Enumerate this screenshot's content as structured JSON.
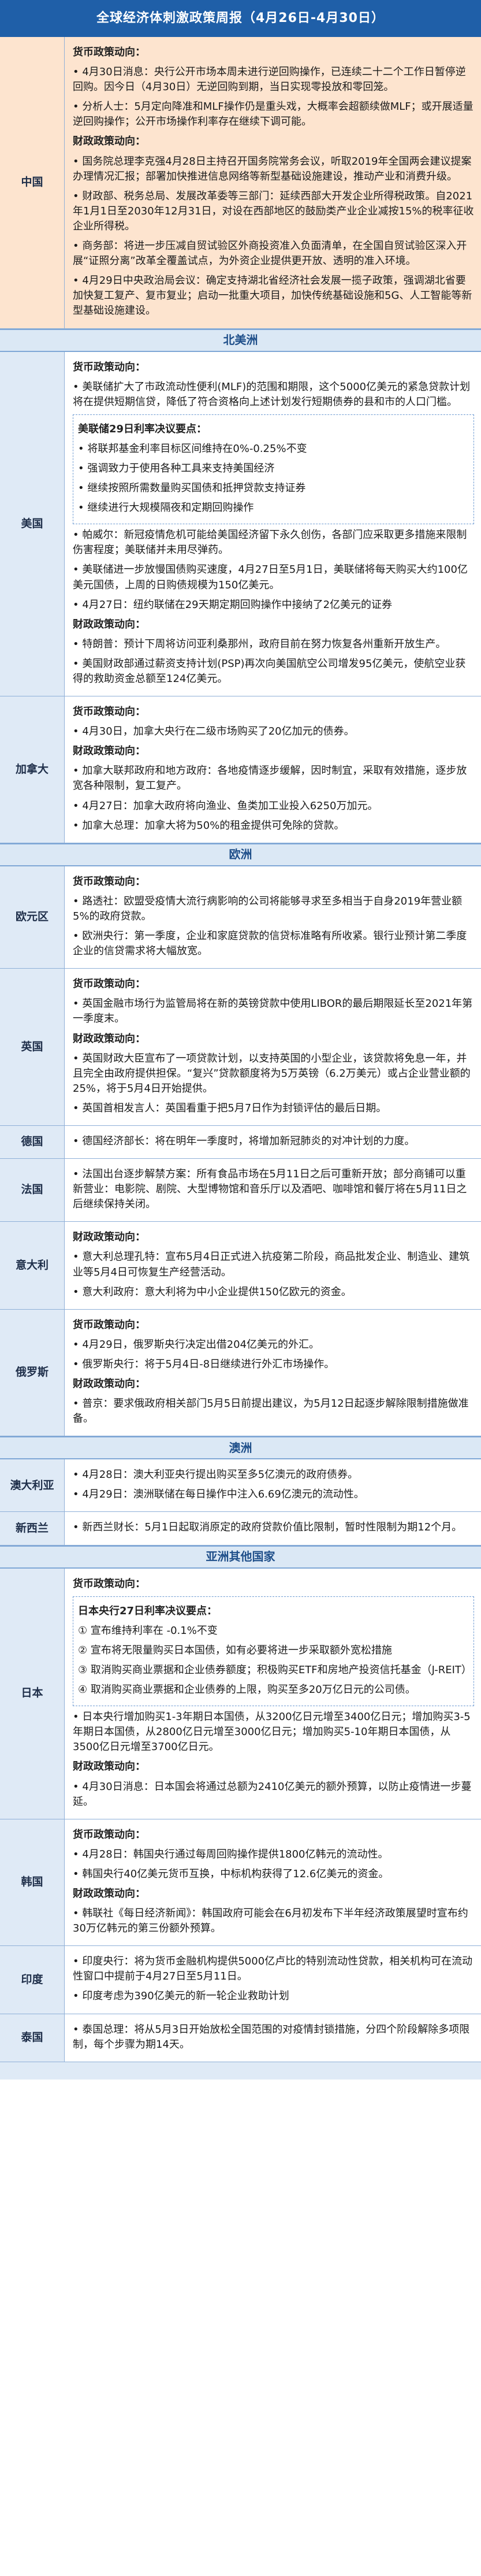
{
  "title": "全球经济体刺激政策周报（4月26日-4月30日）",
  "regions": {
    "north_america": "北美洲",
    "europe": "欧洲",
    "oceania": "澳洲",
    "asia_other": "亚洲其他国家"
  },
  "china": {
    "name": "中国",
    "p1": "货币政策动向：",
    "p2": "• 4月30日消息：央行公开市场本周未进行逆回购操作，已连续二十二个工作日暂停逆回购。因今日（4月30日）无逆回购到期，当日实现零投放和零回笼。",
    "p3": "• 分析人士：5月定向降准和MLF操作仍是重头戏，大概率会超额续做MLF；或开展适量逆回购操作；公开市场操作利率存在继续下调可能。",
    "p4": "财政政策动向：",
    "p5": "• 国务院总理李克强4月28日主持召开国务院常务会议，听取2019年全国两会建议提案办理情况汇报；部署加快推进信息网络等新型基础设施建设，推动产业和消费升级。",
    "p6": "• 财政部、税务总局、发展改革委等三部门：延续西部大开发企业所得税政策。自2021年1月1日至2030年12月31日，对设在西部地区的鼓励类产业企业减按15%的税率征收企业所得税。",
    "p7": "• 商务部：将进一步压减自贸试验区外商投资准入负面清单，在全国自贸试验区深入开展“证照分离”改革全覆盖试点，为外资企业提供更开放、透明的准入环境。",
    "p8": "• 4月29日中央政治局会议：确定支持湖北省经济社会发展一揽子政策，强调湖北省要加快复工复产、复市复业；启动一批重大项目，加快传统基础设施和5G、人工智能等新型基础设施建设。"
  },
  "usa": {
    "name": "美国",
    "p1": "货币政策动向：",
    "p2": "• 美联储扩大了市政流动性便利(MLF)的范围和期限，这个5000亿美元的紧急贷款计划将在提供短期信贷，降低了符合资格向上述计划发行短期债券的县和市的人口门槛。",
    "box_title": "美联储29日利率决议要点：",
    "box_items": [
      "• 将联邦基金利率目标区间维持在0%-0.25%不变",
      "• 强调致力于使用各种工具来支持美国经济",
      "• 继续按照所需数量购买国债和抵押贷款支持证券",
      "• 继续进行大规模隔夜和定期回购操作"
    ],
    "p3": "• 帕威尔：新冠疫情危机可能给美国经济留下永久创伤，各部门应采取更多措施来限制伤害程度；美联储并未用尽弹药。",
    "p4": "• 美联储进一步放慢国债购买速度，4月27日至5月1日，美联储将每天购买大约100亿美元国债，上周的日购债规模为150亿美元。",
    "p5": "• 4月27日：纽约联储在29天期定期回购操作中接纳了2亿美元的证券",
    "p6": "财政政策动向：",
    "p7": "• 特朗普：预计下周将访问亚利桑那州，政府目前在努力恢复各州重新开放生产。",
    "p8": "• 美国财政部通过薪资支持计划(PSP)再次向美国航空公司增发95亿美元，使航空业获得的救助资金总额至124亿美元。"
  },
  "canada": {
    "name": "加拿大",
    "p1": "货币政策动向：",
    "p2": "• 4月30日，加拿大央行在二级市场购买了20亿加元的债券。",
    "p3": "财政政策动向：",
    "p4": "• 加拿大联邦政府和地方政府：各地疫情逐步缓解，因时制宜，采取有效措施，逐步放宽各种限制，复工复产。",
    "p5": "• 4月27日：加拿大政府将向渔业、鱼类加工业投入6250万加元。",
    "p6": "• 加拿大总理：加拿大将为50%的租金提供可免除的贷款。"
  },
  "eurozone": {
    "name": "欧元区",
    "p1": "货币政策动向：",
    "p2": "• 路透社：欧盟受疫情大流行病影响的公司将能够寻求至多相当于自身2019年营业额5%的政府贷款。",
    "p3": "• 欧洲央行：第一季度，企业和家庭贷款的信贷标准略有所收紧。银行业预计第二季度企业的信贷需求将大幅放宽。"
  },
  "uk": {
    "name": "英国",
    "p1": "货币政策动向：",
    "p2": "• 英国金融市场行为监管局将在新的英镑贷款中使用LIBOR的最后期限延长至2021年第一季度末。",
    "p3": "财政政策动向：",
    "p4": "• 英国财政大臣宣布了一项贷款计划，以支持英国的小型企业，该贷款将免息一年，并且完全由政府提供担保。“复兴”贷款额度将为5万英镑（6.2万美元）或占企业营业额的25%，将于5月4日开始提供。",
    "p5": "• 英国首相发言人：英国看重于把5月7日作为封锁评估的最后日期。"
  },
  "germany": {
    "name": "德国",
    "p1": "• 德国经济部长：将在明年一季度时，将增加新冠肺炎的对冲计划的力度。"
  },
  "france": {
    "name": "法国",
    "p1": "• 法国出台逐步解禁方案：所有食品市场在5月11日之后可重新开放；部分商铺可以重新营业：电影院、剧院、大型博物馆和音乐厅以及酒吧、咖啡馆和餐厅将在5月11日之后继续保持关闭。"
  },
  "italy": {
    "name": "意大利",
    "p1": "财政政策动向：",
    "p2": "• 意大利总理孔特：宣布5月4日正式进入抗疫第二阶段，商品批发企业、制造业、建筑业等5月4日可恢复生产经营活动。",
    "p3": "• 意大利政府：意大利将为中小企业提供150亿欧元的资金。"
  },
  "russia": {
    "name": "俄罗斯",
    "p1": "货币政策动向：",
    "p2": "• 4月29日，俄罗斯央行决定出借204亿美元的外汇。",
    "p3": "• 俄罗斯央行：将于5月4日-8日继续进行外汇市场操作。",
    "p4": "财政政策动向：",
    "p5": "• 普京：要求俄政府相关部门5月5日前提出建议，为5月12日起逐步解除限制措施做准备。"
  },
  "australia": {
    "name": "澳大利亚",
    "p1": "• 4月28日：澳大利亚央行提出购买至多5亿澳元的政府债券。",
    "p2": "• 4月29日：澳洲联储在每日操作中注入6.69亿澳元的流动性。"
  },
  "newzealand": {
    "name": "新西兰",
    "p1": "• 新西兰财长：5月1日起取消原定的政府贷款价值比限制，暂时性限制为期12个月。"
  },
  "japan": {
    "name": "日本",
    "p1": "货币政策动向：",
    "box_title": "日本央行27日利率决议要点：",
    "box_items": [
      "① 宣布维持利率在 -0.1%不变",
      "② 宣布将无限量购买日本国债，如有必要将进一步采取额外宽松措施",
      "③ 取消购买商业票据和企业债券额度；积极购买ETF和房地产投资信托基金（J-REIT）",
      "④ 取消购买商业票据和企业债券的上限，购买至多20万亿日元的公司债。"
    ],
    "p2": "• 日本央行增加购买1-3年期日本国债，从3200亿日元增至3400亿日元；增加购买3-5年期日本国债，从2800亿日元增至3000亿日元；增加购买5-10年期日本国债，从3500亿日元增至3700亿日元。",
    "p3": "财政政策动向：",
    "p4": "• 4月30日消息：日本国会将通过总额为2410亿美元的额外预算，以防止疫情进一步蔓延。"
  },
  "korea": {
    "name": "韩国",
    "p1": "货币政策动向：",
    "p2": "• 4月28日：韩国央行通过每周回购操作提供1800亿韩元的流动性。",
    "p3": "• 韩国央行40亿美元货币互换，中标机构获得了12.6亿美元的资金。",
    "p4": "财政政策动向：",
    "p5": "• 韩联社《每日经济新闻》：韩国政府可能会在6月初发布下半年经济政策展望时宣布约30万亿韩元的第三份额外预算。"
  },
  "india": {
    "name": "印度",
    "p1": "• 印度央行：将为货币金融机构提供5000亿卢比的特别流动性贷款，相关机构可在流动性窗口中提前于4月27日至5月11日。",
    "p2": "• 印度考虑为390亿美元的新一轮企业救助计划"
  },
  "thailand": {
    "name": "泰国",
    "p1": "• 泰国总理：将从5月3日开始放松全国范围的对疫情封锁措施，分四个阶段解除多项限制，每个步骤为期14天。"
  }
}
